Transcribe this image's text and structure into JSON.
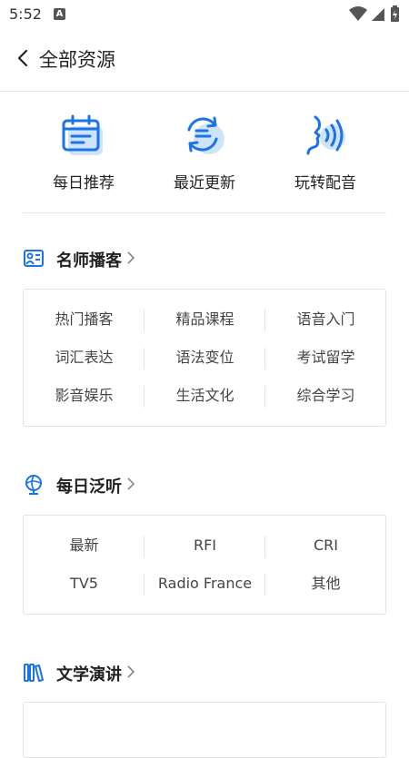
{
  "status_bar": {
    "time": "5:52",
    "notification_icon": "A",
    "icons": [
      "wifi-icon",
      "cell-signal-icon",
      "battery-icon"
    ]
  },
  "header": {
    "title": "全部资源",
    "back_icon": "chevron-left-icon"
  },
  "quick_actions": [
    {
      "label": "每日推荐",
      "icon": "calendar-icon"
    },
    {
      "label": "最近更新",
      "icon": "refresh-icon"
    },
    {
      "label": "玩转配音",
      "icon": "voice-icon"
    }
  ],
  "sections": [
    {
      "title": "名师播客",
      "icon": "podcast-icon",
      "items": [
        [
          "热门播客",
          "精品课程",
          "语音入门"
        ],
        [
          "词汇表达",
          "语法变位",
          "考试留学"
        ],
        [
          "影音娱乐",
          "生活文化",
          "综合学习"
        ]
      ]
    },
    {
      "title": "每日泛听",
      "icon": "globe-icon",
      "items": [
        [
          "最新",
          "RFI",
          "CRI"
        ],
        [
          "TV5",
          "Radio France",
          "其他"
        ]
      ]
    },
    {
      "title": "文学演讲",
      "icon": "books-icon",
      "items": []
    }
  ],
  "colors": {
    "accent": "#1a73e8",
    "accent_light": "#cfe3fb",
    "divider": "#e6e6e6"
  }
}
